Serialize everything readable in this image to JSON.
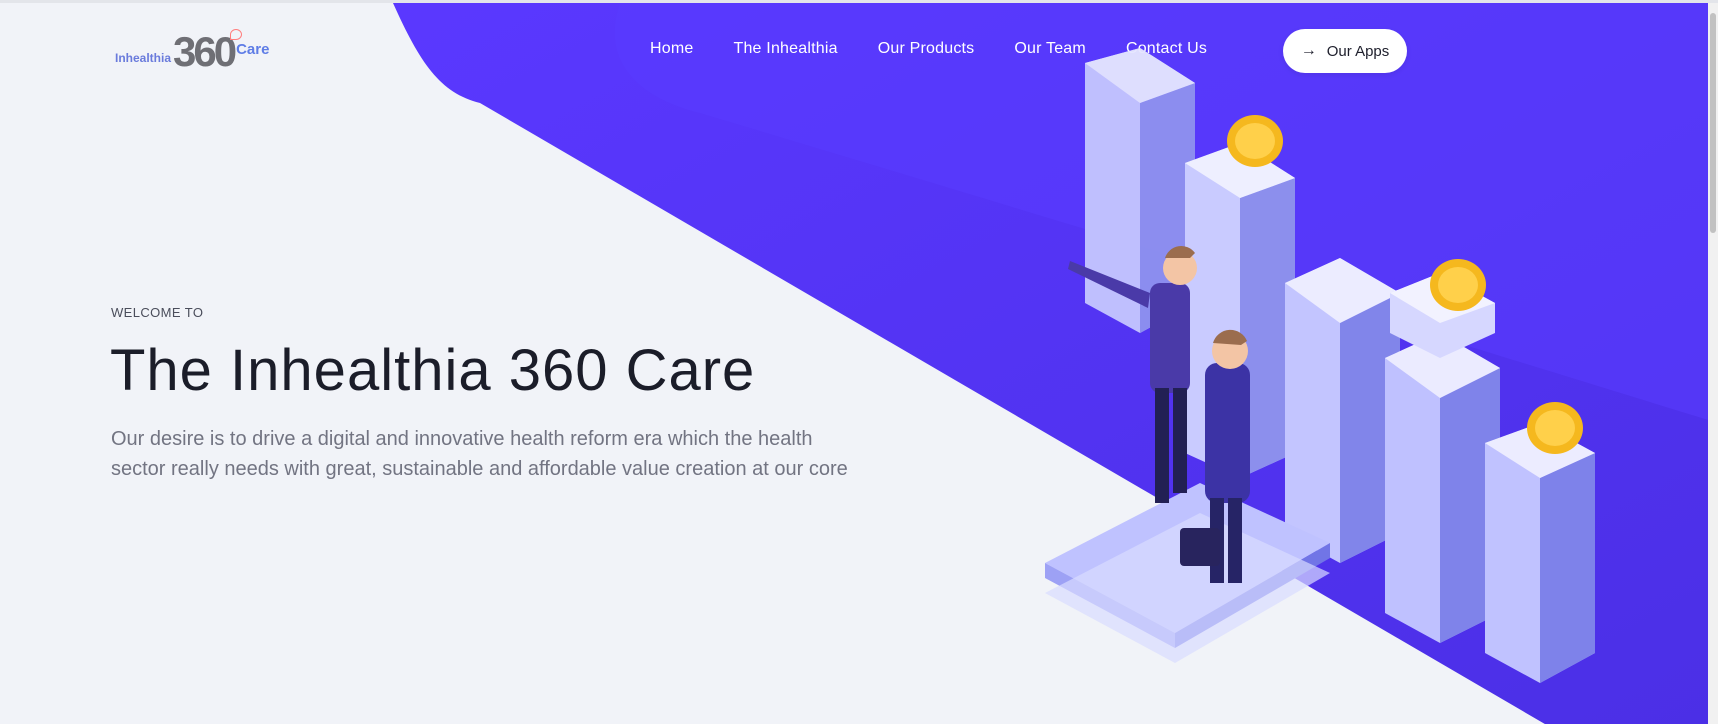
{
  "logo": {
    "part1": "Inhealthia",
    "part2": "360",
    "part3": "Care"
  },
  "nav": {
    "items": [
      {
        "label": "Home"
      },
      {
        "label": "The Inhealthia"
      },
      {
        "label": "Our Products"
      },
      {
        "label": "Our Team"
      },
      {
        "label": "Contact Us"
      }
    ],
    "apps_button": {
      "label": "Our Apps",
      "icon": "arrow-right-icon"
    }
  },
  "hero": {
    "eyebrow": "WELCOME TO",
    "title": "The Inhealthia 360 Care",
    "description": "Our desire is to drive a digital and innovative health reform era which the health sector really needs with great, sustainable and affordable value creation at our core"
  },
  "colors": {
    "accent": "#5436ff",
    "accent_dark": "#4a2ee8",
    "background": "#f1f3f8",
    "logo_blue": "#5f7de6",
    "coin": "#f5b81e"
  }
}
